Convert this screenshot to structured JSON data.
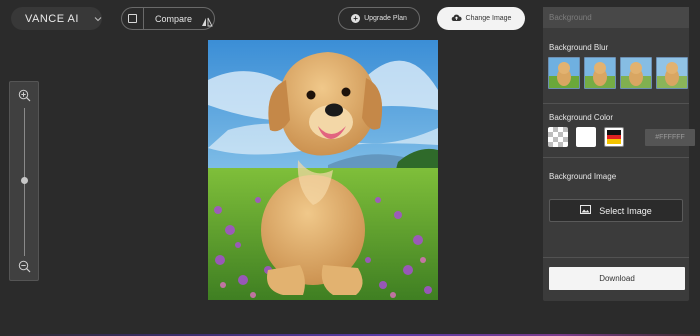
{
  "header": {
    "brand": "VANCE AI",
    "compare_label": "Compare",
    "upgrade_label": "Upgrade Plan",
    "change_image_label": "Change Image"
  },
  "panel": {
    "title": "Background",
    "blur_label": "Background Blur",
    "color_label": "Background Color",
    "hex_placeholder": "#FFFFFF",
    "image_label": "Background Image",
    "select_image_label": "Select Image",
    "download_label": "Download"
  },
  "icons": {
    "brand_menu": "chevron-down-icon",
    "compare_toggle": "checkbox-icon",
    "compare": "split-triangle-icon",
    "upgrade": "plus-circle-icon",
    "change_image": "cloud-upload-icon",
    "zoom_in": "zoom-in-icon",
    "zoom_out": "zoom-out-icon",
    "select_image": "image-icon"
  },
  "colors": {
    "accent_blur_border": "#6c8fb3",
    "download_bg": "#f4f4f4"
  }
}
